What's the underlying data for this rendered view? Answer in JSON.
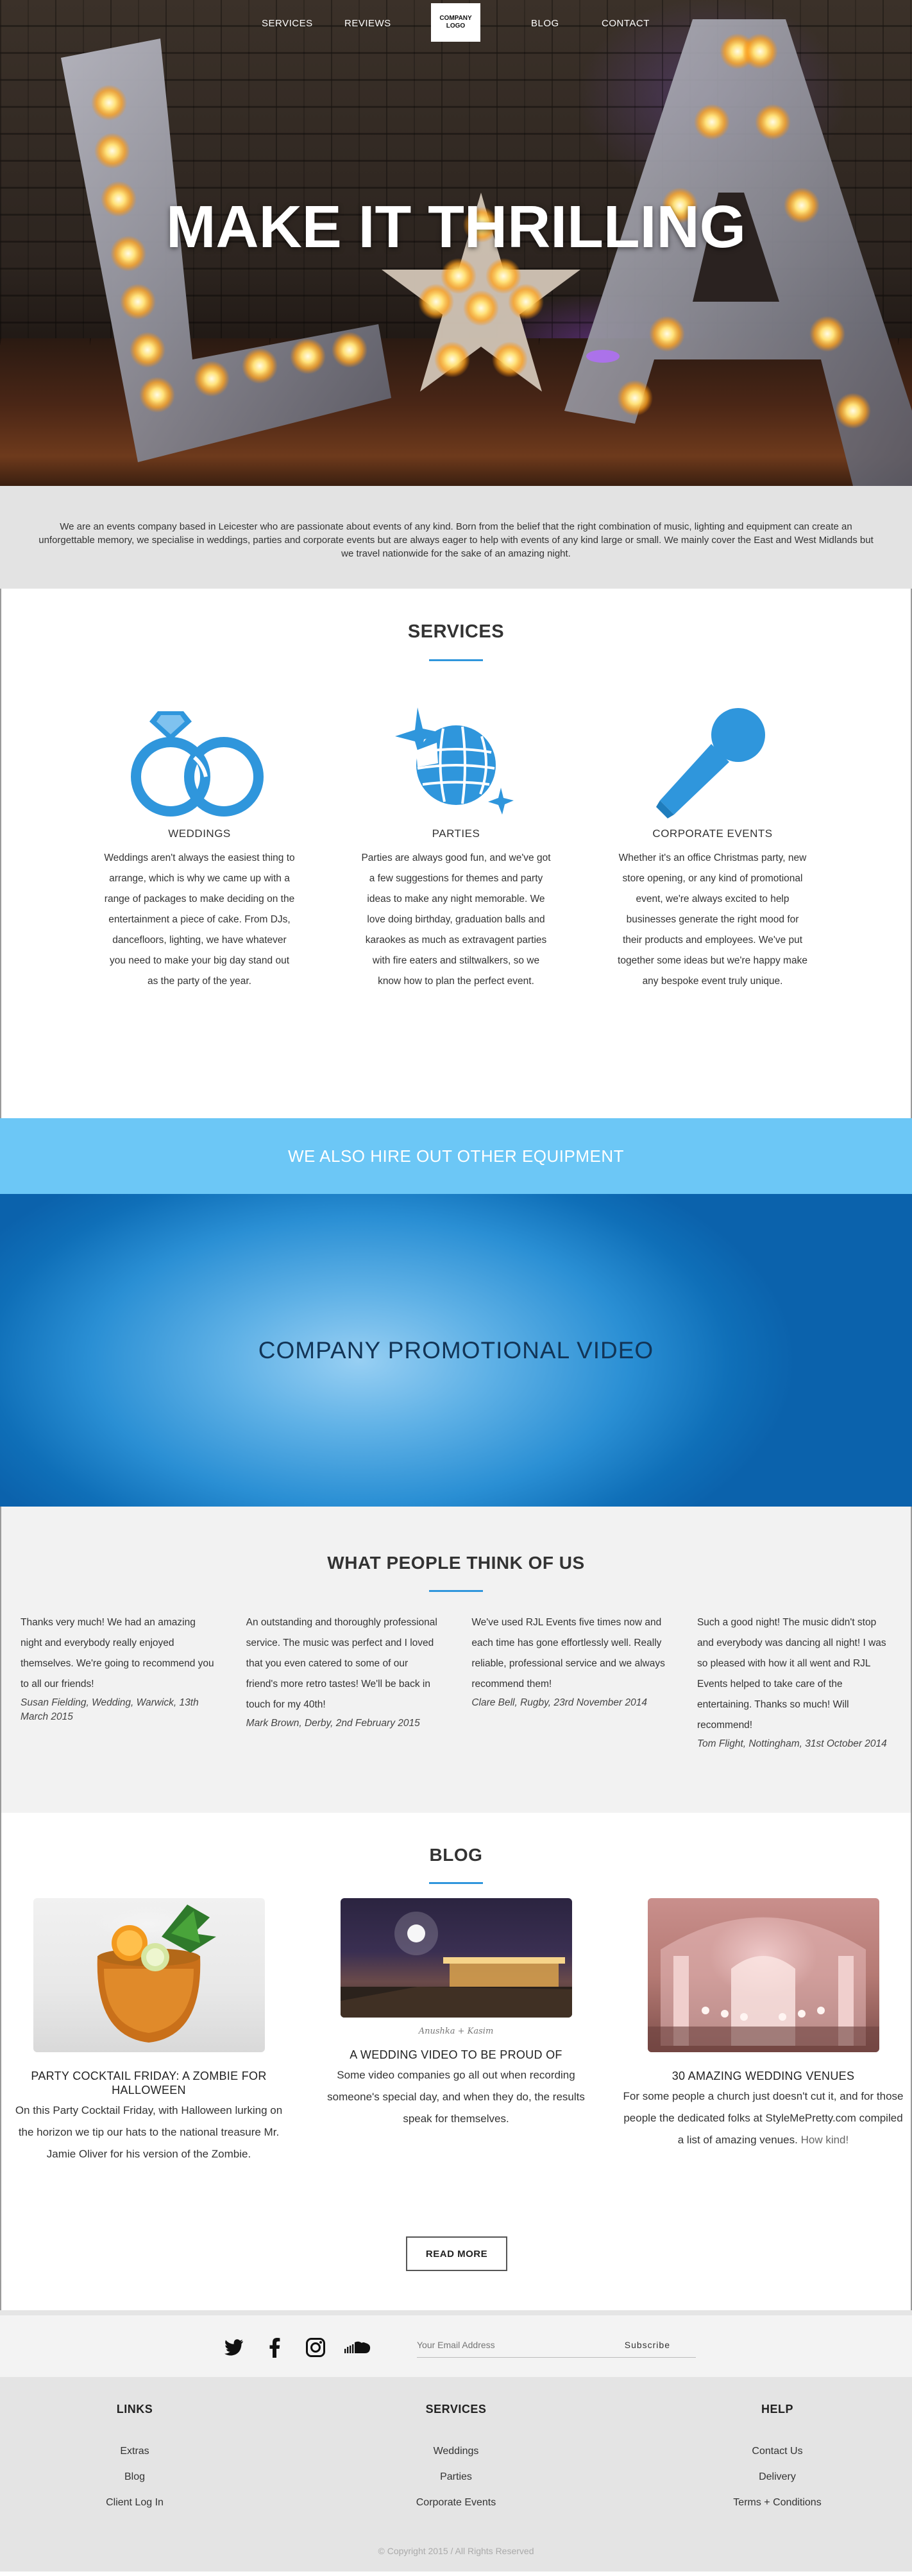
{
  "nav": {
    "items": [
      "SERVICES",
      "REVIEWS",
      "BLOG",
      "CONTACT"
    ],
    "logo_text": "COMPANY LOGO"
  },
  "hero": {
    "title": "MAKE IT THRILLING"
  },
  "intro": {
    "text": "We are an events company based in Leicester who are passionate about events of any kind. Born from the belief that the right combination of music, lighting and equipment can create an unforgettable memory, we specialise in weddings, parties and corporate events but are always eager to help with events of any kind large or small. We mainly cover the East and West Midlands but we travel nationwide for the sake of an amazing night."
  },
  "services": {
    "title": "SERVICES",
    "items": [
      {
        "icon": "wedding-rings-icon",
        "heading": "WEDDINGS",
        "text": "Weddings aren't always the easiest thing to arrange, which is why we came up with a range of packages to make deciding on the entertainment a piece of cake. From DJs, dancefloors, lighting, we have whatever you need to make your big day stand out as the party of the year."
      },
      {
        "icon": "disco-ball-icon",
        "heading": "PARTIES",
        "text": "Parties are always good fun, and we've got a few suggestions for themes and party ideas to make any night memorable. We love doing birthday, graduation balls and karaokes as much as extravagent parties with fire eaters and stiltwalkers, so we know how to plan the perfect event."
      },
      {
        "icon": "microphone-icon",
        "heading": "CORPORATE EVENTS",
        "text": "Whether it's an office Christmas party, new store opening, or any kind of promotional event, we're always excited to help businesses generate the right mood for their products and employees. We've put together some ideas but we're happy make any bespoke event truly unique."
      }
    ]
  },
  "equipment": {
    "label": "WE ALSO HIRE OUT OTHER EQUIPMENT"
  },
  "video": {
    "label": "COMPANY PROMOTIONAL VIDEO"
  },
  "testimonials": {
    "title": "WHAT PEOPLE THINK OF US",
    "items": [
      {
        "quote": "Thanks very much! We had an amazing night and everybody really enjoyed themselves. We're going to recommend you to all our friends!",
        "author": "Susan Fielding, Wedding, Warwick, 13th March 2015"
      },
      {
        "quote": "An outstanding and thoroughly professional service. The music was perfect and I loved that you even catered to some of our friend's more retro tastes! We'll be back in touch for my 40th!",
        "author": "Mark Brown, Derby, 2nd February 2015"
      },
      {
        "quote": "We've used RJL Events five times now and each time has gone effortlessly well. Really reliable, professional service and we always recommend them!",
        "author": "Clare Bell, Rugby, 23rd November 2014"
      },
      {
        "quote": "Such a good night! The music didn't stop and everybody was dancing all night! I was so pleased with how it all went and RJL Events helped to take care of the entertaining. Thanks so much! Will recommend!",
        "author": "Tom Flight, Nottingham, 31st October 2014"
      }
    ]
  },
  "blog": {
    "title": "BLOG",
    "posts": [
      {
        "heading": "PARTY COCKTAIL FRIDAY: A ZOMBIE FOR HALLOWEEN",
        "text": "On this Party Cocktail Friday, with Halloween lurking on the horizon we tip our hats to the national treasure Mr. Jamie Oliver for his version of the Zombie.",
        "caption": ""
      },
      {
        "heading": "A WEDDING VIDEO TO BE PROUD OF",
        "text": "Some video companies go all out when recording someone's special day, and when they do, the results speak for themselves.",
        "caption": "Anushka + Kasim"
      },
      {
        "heading": "30 AMAZING WEDDING VENUES",
        "text": "For some people a church just doesn't cut it, and for those people the dedicated folks at StyleMePretty.com compiled a list of amazing venues.",
        "text_tail": "How kind!",
        "caption": ""
      }
    ],
    "read_more": "READ MORE"
  },
  "social": {
    "icons": [
      "twitter-icon",
      "facebook-icon",
      "instagram-icon",
      "soundcloud-icon"
    ],
    "email_placeholder": "Your Email Address",
    "subscribe_label": "Subscribe"
  },
  "footer": {
    "columns": [
      {
        "heading": "LINKS",
        "links": [
          "Extras",
          "Blog",
          "Client Log In"
        ]
      },
      {
        "heading": "SERVICES",
        "links": [
          "Weddings",
          "Parties",
          "Corporate Events"
        ]
      },
      {
        "heading": "HELP",
        "links": [
          "Contact Us",
          "Delivery",
          "Terms + Conditions"
        ]
      }
    ],
    "copyright": "© Copyright 2015 / All Rights Reserved"
  },
  "colors": {
    "accent": "#2f96dc",
    "equipment_bar": "#6cc7f6",
    "intro_bg": "#e3e3e3",
    "footer_bg": "#e4e4e4"
  }
}
